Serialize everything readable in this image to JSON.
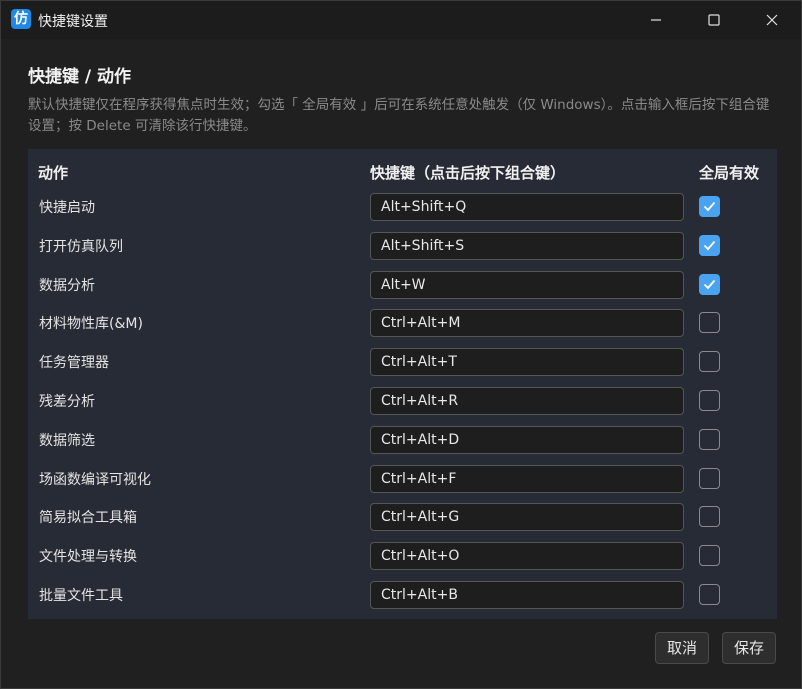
{
  "window": {
    "title": "快捷键设置",
    "icon_glyph": "仿"
  },
  "page": {
    "heading": "快捷键 / 动作",
    "description": "默认快捷键仅在程序获得焦点时生效；勾选「 全局有效 」后可在系统任意处触发（仅 Windows）。点击输入框后按下组合键设置；按 Delete 可清除该行快捷键。"
  },
  "table": {
    "headers": {
      "action": "动作",
      "shortcut": "快捷键（点击后按下组合键）",
      "global": "全局有效"
    },
    "rows": [
      {
        "action": "快捷启动",
        "shortcut": "Alt+Shift+Q",
        "global": true
      },
      {
        "action": "打开仿真队列",
        "shortcut": "Alt+Shift+S",
        "global": true
      },
      {
        "action": "数据分析",
        "shortcut": "Alt+W",
        "global": true
      },
      {
        "action": "材料物性库(&M)",
        "shortcut": "Ctrl+Alt+M",
        "global": false
      },
      {
        "action": "任务管理器",
        "shortcut": "Ctrl+Alt+T",
        "global": false
      },
      {
        "action": "残差分析",
        "shortcut": "Ctrl+Alt+R",
        "global": false
      },
      {
        "action": "数据筛选",
        "shortcut": "Ctrl+Alt+D",
        "global": false
      },
      {
        "action": "场函数编译可视化",
        "shortcut": "Ctrl+Alt+F",
        "global": false
      },
      {
        "action": "简易拟合工具箱",
        "shortcut": "Ctrl+Alt+G",
        "global": false
      },
      {
        "action": "文件处理与转换",
        "shortcut": "Ctrl+Alt+O",
        "global": false
      },
      {
        "action": "批量文件工具",
        "shortcut": "Ctrl+Alt+B",
        "global": false
      }
    ]
  },
  "footer": {
    "cancel_label": "取消",
    "save_label": "保存"
  },
  "colors": {
    "accent": "#4aa3f0",
    "panel": "#272b35",
    "background": "#202020"
  }
}
